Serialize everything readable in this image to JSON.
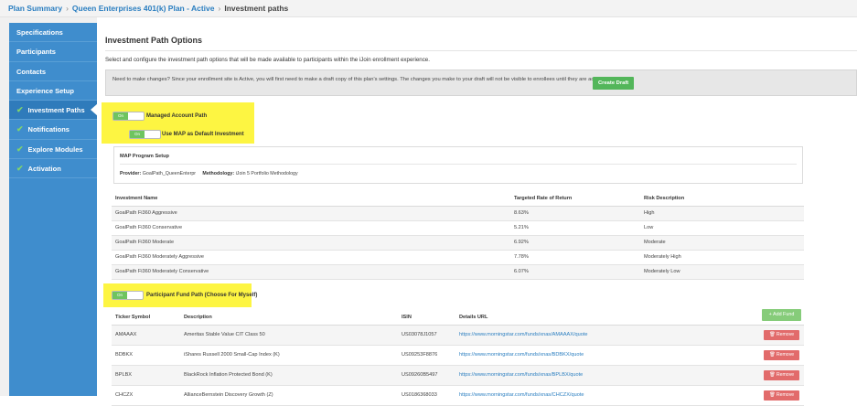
{
  "breadcrumb": {
    "items": [
      "Plan Summary",
      "Queen Enterprises 401(k) Plan - Active"
    ],
    "current": "Investment paths",
    "separator": "›"
  },
  "sidebar": {
    "items": [
      {
        "label": "Specifications"
      },
      {
        "label": "Participants"
      },
      {
        "label": "Contacts"
      },
      {
        "label": "Experience Setup"
      },
      {
        "label": "Investment Paths"
      },
      {
        "label": "Notifications"
      },
      {
        "label": "Explore Modules"
      },
      {
        "label": "Activation"
      }
    ],
    "check_glyph": "✔"
  },
  "main": {
    "title": "Investment Path Options",
    "description": "Select and configure the investment path options that will be made available to participants within the iJoin enrollment experience.",
    "notice": {
      "text": "Need to make changes? Since your enrollment site is Active, you will first need to make a draft copy of this plan's settings. The changes you make to your draft will not be visible to enrollees until they are activated.",
      "button": "Create Draft"
    }
  },
  "toggles": {
    "on_label": "On",
    "managed_account": "Managed Account Path",
    "map_default": "Use MAP as Default Investment",
    "participant_fund": "Participant Fund Path (Choose For Myself)"
  },
  "map_setup": {
    "heading": "MAP Program Setup",
    "provider_label": "Provider:",
    "provider_value": "GoalPath_QueenEnterpr",
    "methodology_label": "Methodology:",
    "methodology_value": "iJoin 5 Portfolio Methodology"
  },
  "investments": {
    "headers": [
      "Investment Name",
      "Targeted Rate of Return",
      "Risk Description"
    ],
    "rows": [
      [
        "GoalPath Fi360 Aggressive",
        "8.63%",
        "High"
      ],
      [
        "GoalPath Fi360 Conservative",
        "5.21%",
        "Low"
      ],
      [
        "GoalPath Fi360 Moderate",
        "6.92%",
        "Moderate"
      ],
      [
        "GoalPath Fi360 Moderately Aggressive",
        "7.78%",
        "Moderately High"
      ],
      [
        "GoalPath Fi360 Moderately Conservative",
        "6.07%",
        "Moderately Low"
      ]
    ]
  },
  "funds": {
    "add_button": "+ Add Fund",
    "headers": [
      "Ticker Symbol",
      "Description",
      "ISIN",
      "Details URL",
      ""
    ],
    "remove_label": "🗑 Remove",
    "rows": [
      [
        "AMAAAX",
        "Ameritas Stable Value CIT Class 50",
        "US03078J1057",
        "https://www.morningstar.com/funds/xnas/AMAAAX/quote"
      ],
      [
        "BDBKX",
        "iShares Russell 2000 Small-Cap Index (K)",
        "US09253F8876",
        "https://www.morningstar.com/funds/xnas/BDBKX/quote"
      ],
      [
        "BPLBX",
        "BlackRock Inflation Protected Bond (K)",
        "US09260B5497",
        "https://www.morningstar.com/funds/xnas/BPLBX/quote"
      ],
      [
        "CHCZX",
        "AllianceBernstein Discovery Growth (Z)",
        "US0186368033",
        "https://www.morningstar.com/funds/xnas/CHCZX/quote"
      ]
    ]
  },
  "colors": {
    "sidebar": "#3f8dcd",
    "highlight": "#fdf542",
    "toggle_on": "#6fc45f",
    "create_draft": "#53b65a",
    "remove": "#e26b6b",
    "link": "#2a7ec0"
  }
}
